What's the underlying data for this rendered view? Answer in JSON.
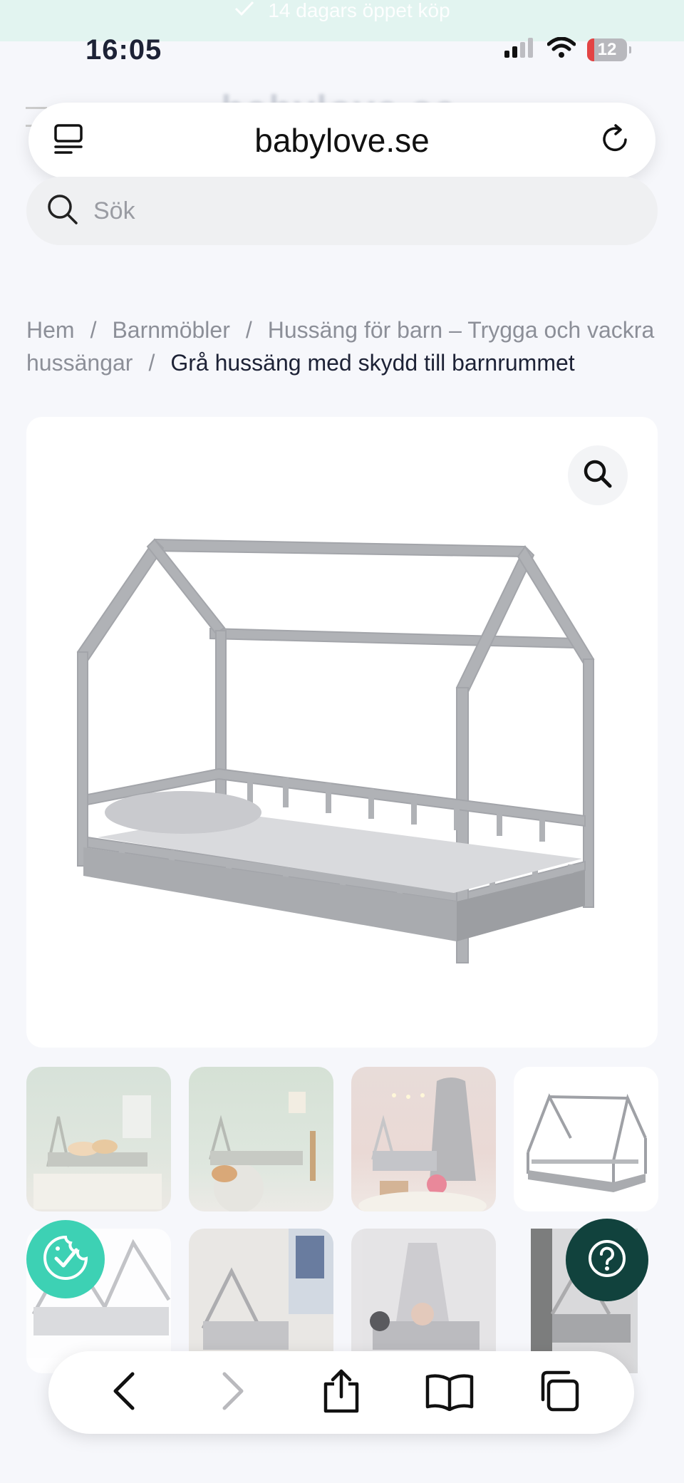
{
  "promo": {
    "text": "14 dagars öppet köp",
    "icon": "check-icon"
  },
  "status_bar": {
    "time": "16:05",
    "battery": "12"
  },
  "site": {
    "logo_text": "babylove.se"
  },
  "browser": {
    "url": "babylove.se"
  },
  "search": {
    "placeholder": "Sök"
  },
  "breadcrumb": {
    "items": [
      "Hem",
      "Barnmöbler",
      "Hussäng för barn – Trygga och vackra hussängar"
    ],
    "separator": "/",
    "current": "Grå hussäng med skydd till barnrummet"
  },
  "colors": {
    "accent": "#3dd1b4",
    "help": "#11423d",
    "bed": "#a9abaf"
  },
  "toolbar": {
    "icons": [
      "back-icon",
      "forward-icon",
      "share-icon",
      "bookmarks-icon",
      "tabs-icon"
    ]
  }
}
